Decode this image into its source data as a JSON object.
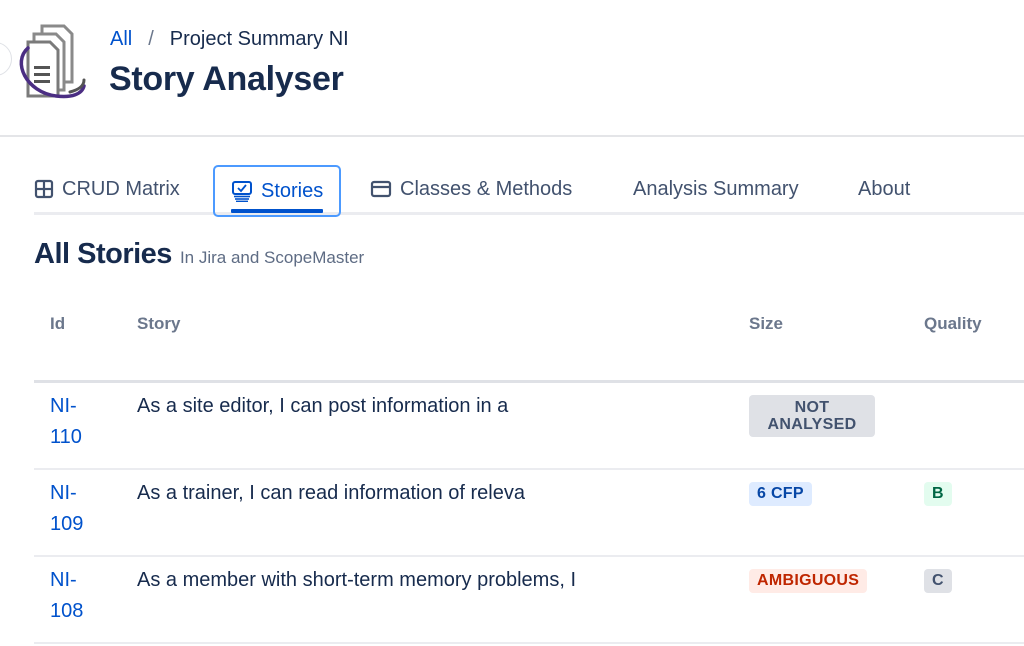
{
  "header": {
    "breadcrumb": {
      "root": "All",
      "separator": "/",
      "current": "Project Summary NI"
    },
    "title": "Story Analyser",
    "logo_icon": "documents-orbit-logo"
  },
  "tabs": [
    {
      "label": "CRUD Matrix",
      "icon": "grid-icon",
      "active": false
    },
    {
      "label": "Stories",
      "icon": "monitor-check-icon",
      "active": true
    },
    {
      "label": "Classes & Methods",
      "icon": "window-icon",
      "active": false
    },
    {
      "label": "Analysis Summary",
      "icon": null,
      "active": false
    },
    {
      "label": "About",
      "icon": null,
      "active": false
    }
  ],
  "section": {
    "title": "All Stories",
    "subtitle": "In Jira and ScopeMaster"
  },
  "table": {
    "columns": [
      "Id",
      "Story",
      "Size",
      "Quality"
    ],
    "rows": [
      {
        "id": "NI-110",
        "id_line1": "NI-",
        "id_line2": "110",
        "story": "As a site editor, I can post information in a",
        "size": "NOT ANALYSED",
        "size_line1": "NOT",
        "size_line2": "ANALYSED",
        "size_style": "default",
        "quality": ""
      },
      {
        "id": "NI-109",
        "id_line1": "NI-",
        "id_line2": "109",
        "story": "As a trainer, I can read information of releva",
        "size": "6 CFP",
        "size_style": "blue",
        "quality": "B",
        "quality_style": "green"
      },
      {
        "id": "NI-108",
        "id_line1": "NI-",
        "id_line2": "108",
        "story": "As a member with short-term memory problems, I",
        "size": "AMBIGUOUS",
        "size_style": "red",
        "quality": "C",
        "quality_style": "default"
      }
    ]
  },
  "colors": {
    "link": "#0052cc",
    "active_tab_border": "#4c9aff",
    "text_primary": "#172b4d",
    "text_subtle": "#6b778c"
  }
}
